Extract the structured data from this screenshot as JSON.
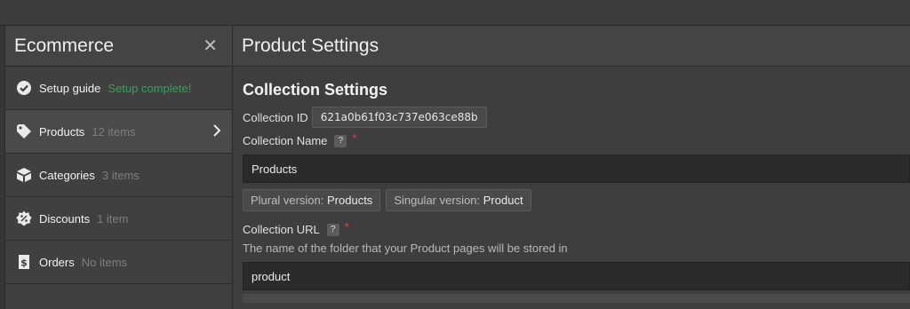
{
  "sidebar": {
    "title": "Ecommerce",
    "items": [
      {
        "label": "Setup guide",
        "meta": "Setup complete!",
        "icon": "check-circle-icon",
        "status_color": "#2ea35e"
      },
      {
        "label": "Products",
        "meta": "12 items",
        "icon": "tag-icon"
      },
      {
        "label": "Categories",
        "meta": "3 items",
        "icon": "box-icon"
      },
      {
        "label": "Discounts",
        "meta": "1 item",
        "icon": "discount-badge-icon"
      },
      {
        "label": "Orders",
        "meta": "No items",
        "icon": "dollar-receipt-icon"
      }
    ]
  },
  "main": {
    "title": "Product Settings",
    "section_title": "Collection Settings",
    "collection_id": {
      "label": "Collection ID",
      "value": "621a0b61f03c737e063ce88b"
    },
    "collection_name": {
      "label": "Collection Name",
      "help": "?",
      "required": "*",
      "value": "Products"
    },
    "plural": {
      "label": "Plural version:",
      "value": "Products"
    },
    "singular": {
      "label": "Singular version:",
      "value": "Product"
    },
    "collection_url": {
      "label": "Collection URL",
      "help": "?",
      "required": "*",
      "description": "The name of the folder that your Product pages will be stored in",
      "value": "product"
    }
  }
}
